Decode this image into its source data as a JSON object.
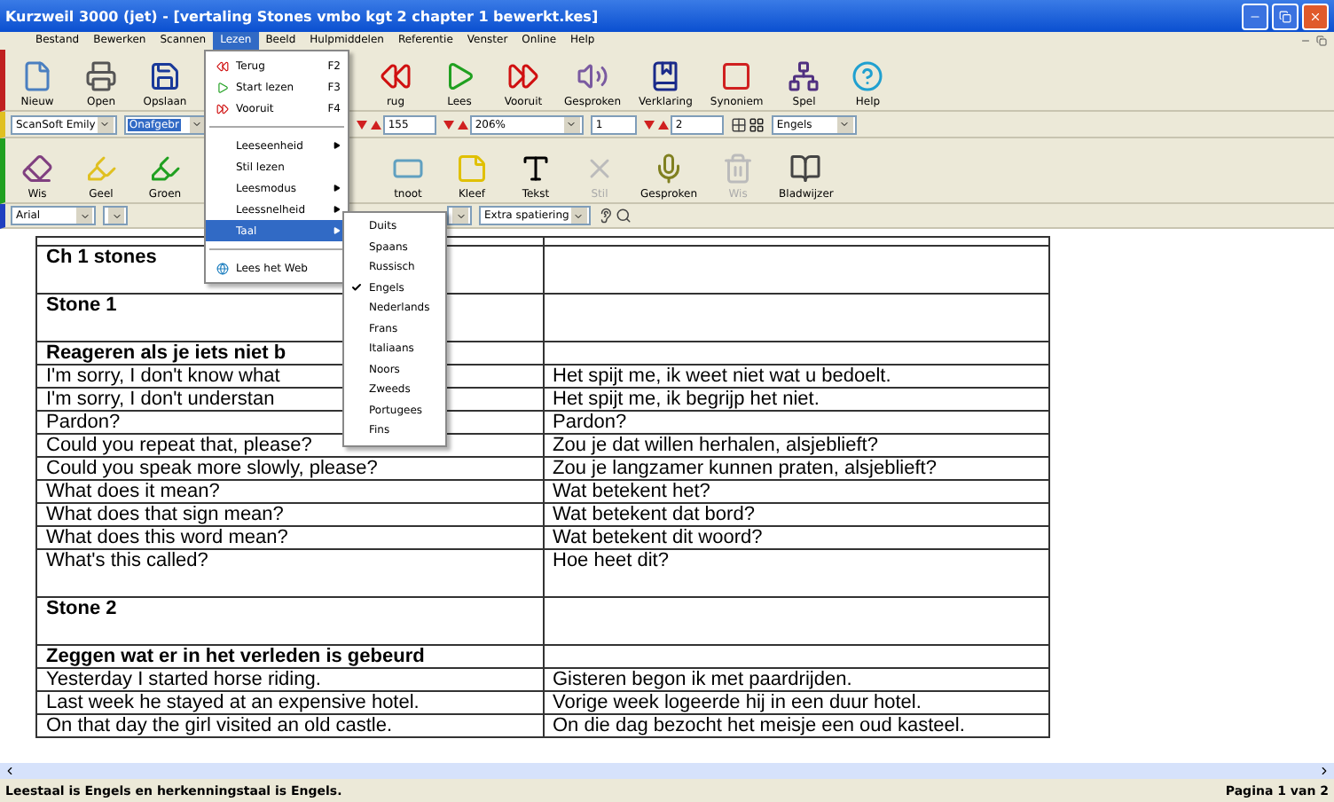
{
  "window": {
    "title": "Kurzweil 3000 (jet) - [vertaling Stones vmbo kgt 2 chapter 1 bewerkt.kes]"
  },
  "menu_bar": [
    {
      "label": "Bestand",
      "selected": false
    },
    {
      "label": "Bewerken",
      "selected": false
    },
    {
      "label": "Scannen",
      "selected": false
    },
    {
      "label": "Lezen",
      "selected": true
    },
    {
      "label": "Beeld",
      "selected": false
    },
    {
      "label": "Hulpmiddelen",
      "selected": false
    },
    {
      "label": "Referentie",
      "selected": false
    },
    {
      "label": "Venster",
      "selected": false
    },
    {
      "label": "Online",
      "selected": false
    },
    {
      "label": "Help",
      "selected": false
    }
  ],
  "toolbar_main": [
    {
      "label": "Nieuw"
    },
    {
      "label": "Open"
    },
    {
      "label": "Opslaan"
    },
    {
      "label": "rug"
    },
    {
      "label": "Lees"
    },
    {
      "label": "Vooruit"
    },
    {
      "label": "Gesproken"
    },
    {
      "label": "Verklaring"
    },
    {
      "label": "Synoniem"
    },
    {
      "label": "Spel"
    },
    {
      "label": "Help"
    }
  ],
  "toolbar_voice": [
    {
      "kind": "combo",
      "value": "ScanSoft Emily",
      "highlighted": false
    },
    {
      "kind": "combo",
      "value": "Onafgebr",
      "highlighted": true
    },
    {
      "kind": "spin",
      "value": "155"
    },
    {
      "kind": "spin_combo",
      "value": "206%"
    },
    {
      "kind": "field",
      "value": "1"
    },
    {
      "kind": "spin",
      "value": "2"
    },
    {
      "kind": "icon_pair"
    },
    {
      "kind": "combo",
      "value": "Engels",
      "highlighted": false
    }
  ],
  "toolbar_tools": [
    {
      "label": "Wis",
      "disabled": false
    },
    {
      "label": "Geel",
      "disabled": false
    },
    {
      "label": "Groen",
      "disabled": false
    },
    {
      "label": "tnoot",
      "disabled": false
    },
    {
      "label": "Kleef",
      "disabled": false
    },
    {
      "label": "Tekst",
      "disabled": false
    },
    {
      "label": "Stil",
      "disabled": true
    },
    {
      "label": "Gesproken",
      "disabled": false
    },
    {
      "label": "Wis",
      "disabled": true
    },
    {
      "label": "Bladwijzer",
      "disabled": false
    }
  ],
  "toolbar_format": [
    {
      "kind": "combo",
      "value": "Arial"
    },
    {
      "kind": "combo"
    },
    {
      "kind": "combo"
    },
    {
      "kind": "combo",
      "value": "Extra spatiering"
    },
    {
      "kind": "icon_pair"
    }
  ],
  "open_menu": {
    "items": [
      {
        "kind": "command",
        "label": "Terug",
        "shortcut": "F2",
        "selected": false
      },
      {
        "kind": "command",
        "label": "Start lezen",
        "shortcut": "F3",
        "selected": false
      },
      {
        "kind": "command",
        "label": "Vooruit",
        "shortcut": "F4",
        "selected": false
      },
      {
        "kind": "separator"
      },
      {
        "kind": "submenu",
        "label": "Leeseenheid",
        "selected": false
      },
      {
        "kind": "plain",
        "label": "Stil lezen",
        "selected": false
      },
      {
        "kind": "submenu",
        "label": "Leesmodus",
        "selected": false
      },
      {
        "kind": "submenu",
        "label": "Leessnelheid",
        "selected": false
      },
      {
        "kind": "submenu",
        "label": "Taal",
        "selected": true
      },
      {
        "kind": "separator"
      },
      {
        "kind": "command",
        "label": "Lees het Web",
        "selected": false
      }
    ]
  },
  "language_submenu": [
    {
      "label": "Duits",
      "checked": false
    },
    {
      "label": "Spaans",
      "checked": false
    },
    {
      "label": "Russisch",
      "checked": false
    },
    {
      "label": "Engels",
      "checked": true
    },
    {
      "label": "Nederlands",
      "checked": false
    },
    {
      "label": "Frans",
      "checked": false
    },
    {
      "label": "Italiaans",
      "checked": false
    },
    {
      "label": "Noors",
      "checked": false
    },
    {
      "label": "Zweeds",
      "checked": false
    },
    {
      "label": "Portugees",
      "checked": false
    },
    {
      "label": "Fins",
      "checked": false
    }
  ],
  "document": {
    "rows": [
      {
        "kind": "heading",
        "left": "Ch 1 stones"
      },
      {
        "kind": "heading",
        "left": "Stone 1"
      },
      {
        "kind": "section",
        "left": "Reageren als je iets niet b"
      },
      {
        "kind": "line",
        "left": "I'm sorry, I don't know what",
        "right": "Het spijt me, ik weet niet wat u bedoelt."
      },
      {
        "kind": "line",
        "left": "I'm sorry, I don't understan",
        "right": "Het spijt me, ik begrijp het niet."
      },
      {
        "kind": "line",
        "left": "Pardon?",
        "right": "Pardon?"
      },
      {
        "kind": "line",
        "left": "Could you repeat that, please?",
        "right": "Zou je dat willen herhalen, alsjeblieft?"
      },
      {
        "kind": "line",
        "left": "Could you speak more slowly, please?",
        "right": "Zou je langzamer kunnen praten, alsjeblieft?"
      },
      {
        "kind": "line",
        "left": "What does it mean?",
        "right": "Wat betekent het?"
      },
      {
        "kind": "line",
        "left": "What does that sign mean?",
        "right": "Wat betekent dat bord?"
      },
      {
        "kind": "line",
        "left": "What does this word mean?",
        "right": "Wat betekent dit woord?"
      },
      {
        "kind": "tall",
        "left": "What's this called?",
        "right": "Hoe heet dit?"
      },
      {
        "kind": "heading",
        "left": "Stone 2"
      },
      {
        "kind": "section",
        "left": "Zeggen wat er in het verleden is gebeurd"
      },
      {
        "kind": "line",
        "left": "Yesterday I started horse riding.",
        "right": "Gisteren begon ik met paardrijden."
      },
      {
        "kind": "line",
        "left": "Last week he stayed at an expensive hotel.",
        "right": "Vorige week logeerde hij in een duur hotel."
      },
      {
        "kind": "line",
        "left": "On that day the girl visited an old castle.",
        "right": "On die dag bezocht het meisje een oud kasteel."
      }
    ]
  },
  "status_bar": {
    "message": "Leestaal is Engels en herkenningstaal is Engels.",
    "page": "Pagina 1 van 2"
  }
}
